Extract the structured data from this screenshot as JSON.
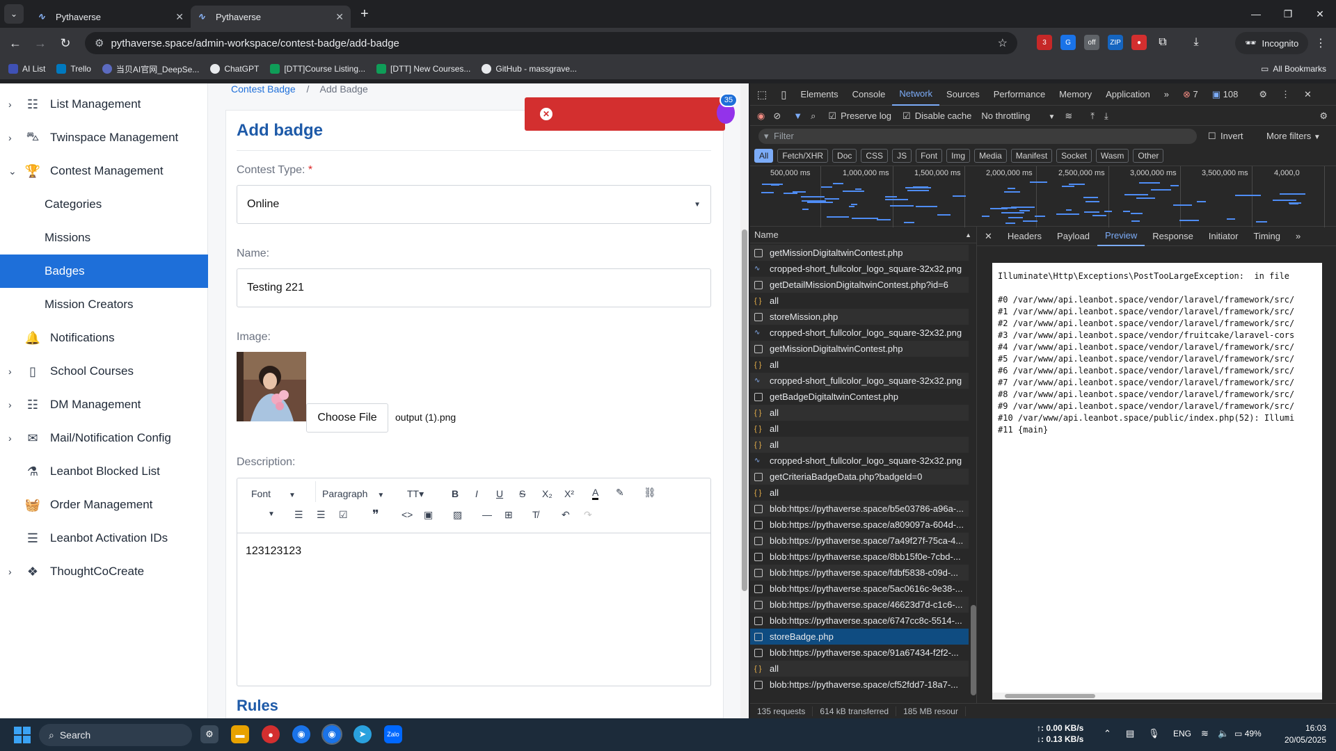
{
  "browser": {
    "tabs": [
      {
        "title": "Pythaverse"
      },
      {
        "title": "Pythaverse"
      }
    ],
    "url": "pythaverse.space/admin-workspace/contest-badge/add-badge",
    "incognito_label": "Incognito",
    "bookmarks": [
      "AI List",
      "Trello",
      "当贝AI官网_DeepSe...",
      "ChatGPT",
      "[DTT]Course Listing...",
      "[DTT] New Courses...",
      "GitHub - massgrave..."
    ],
    "all_bookmarks": "All Bookmarks"
  },
  "sidebar": {
    "items": [
      {
        "label": "List Management",
        "icon": "list-icon",
        "expandable": true,
        "chev": "›"
      },
      {
        "label": "Twinspace Management",
        "icon": "car-icon",
        "expandable": true,
        "chev": "›"
      },
      {
        "label": "Contest Management",
        "icon": "trophy-icon",
        "expandable": true,
        "chev": "⌄"
      },
      {
        "label": "Categories",
        "sub": true
      },
      {
        "label": "Missions",
        "sub": true
      },
      {
        "label": "Badges",
        "sub": true,
        "active": true
      },
      {
        "label": "Mission Creators",
        "sub": true
      },
      {
        "label": "Notifications",
        "icon": "bell-icon"
      },
      {
        "label": "School Courses",
        "icon": "book-icon",
        "expandable": true,
        "chev": "›"
      },
      {
        "label": "DM Management",
        "icon": "list-icon",
        "expandable": true,
        "chev": "›"
      },
      {
        "label": "Mail/Notification Config",
        "icon": "mail-icon",
        "expandable": true,
        "chev": "›"
      },
      {
        "label": "Leanbot Blocked List",
        "icon": "flask-icon"
      },
      {
        "label": "Order Management",
        "icon": "basket-icon"
      },
      {
        "label": "Leanbot Activation IDs",
        "icon": "checklist-icon"
      },
      {
        "label": "ThoughtCoCreate",
        "icon": "cubes-icon",
        "expandable": true,
        "chev": "›"
      }
    ]
  },
  "main": {
    "breadcrumb": {
      "parent": "Contest Badge",
      "sep": "/",
      "current": "Add Badge"
    },
    "title": "Add badge",
    "contest_type": {
      "label": "Contest Type:",
      "required": "*",
      "value": "Online"
    },
    "name": {
      "label": "Name:",
      "value": "Testing 221"
    },
    "image": {
      "label": "Image:",
      "button": "Choose File",
      "filename": "output (1).png"
    },
    "description": {
      "label": "Description:",
      "font": "Font",
      "paragraph": "Paragraph",
      "text": "123123123"
    },
    "rules_heading": "Rules",
    "notification_count": "35"
  },
  "devtools": {
    "tabs": [
      "Elements",
      "Console",
      "Network",
      "Sources",
      "Performance",
      "Memory",
      "Application"
    ],
    "active_tab": "Network",
    "errors": "7",
    "messages": "108",
    "toolbar": {
      "preserve_log": "Preserve log",
      "disable_cache": "Disable cache",
      "throttling": "No throttling"
    },
    "filter_placeholder": "Filter",
    "invert": "Invert",
    "more_filters": "More filters",
    "type_filters": [
      "All",
      "Fetch/XHR",
      "Doc",
      "CSS",
      "JS",
      "Font",
      "Img",
      "Media",
      "Manifest",
      "Socket",
      "Wasm",
      "Other"
    ],
    "timeline_labels": [
      "500,000 ms",
      "1,000,000 ms",
      "1,500,000 ms",
      "2,000,000 ms",
      "2,500,000 ms",
      "3,000,000 ms",
      "3,500,000 ms",
      "4,000,0"
    ],
    "name_header": "Name",
    "requests": [
      {
        "name": "getMissionDigitaltwinContest.php",
        "type": "doc"
      },
      {
        "name": "cropped-short_fullcolor_logo_square-32x32.png",
        "type": "img"
      },
      {
        "name": "getDetailMissionDigitaltwinContest.php?id=6",
        "type": "doc"
      },
      {
        "name": "all",
        "type": "fetch"
      },
      {
        "name": "storeMission.php",
        "type": "doc"
      },
      {
        "name": "cropped-short_fullcolor_logo_square-32x32.png",
        "type": "img"
      },
      {
        "name": "getMissionDigitaltwinContest.php",
        "type": "doc"
      },
      {
        "name": "all",
        "type": "fetch"
      },
      {
        "name": "cropped-short_fullcolor_logo_square-32x32.png",
        "type": "img"
      },
      {
        "name": "getBadgeDigitaltwinContest.php",
        "type": "doc"
      },
      {
        "name": "all",
        "type": "fetch"
      },
      {
        "name": "all",
        "type": "fetch"
      },
      {
        "name": "all",
        "type": "fetch"
      },
      {
        "name": "cropped-short_fullcolor_logo_square-32x32.png",
        "type": "img"
      },
      {
        "name": "getCriteriaBadgeData.php?badgeId=0",
        "type": "doc"
      },
      {
        "name": "all",
        "type": "fetch"
      },
      {
        "name": "blob:https://pythaverse.space/b5e03786-a96a-...",
        "type": "doc"
      },
      {
        "name": "blob:https://pythaverse.space/a809097a-604d-...",
        "type": "doc"
      },
      {
        "name": "blob:https://pythaverse.space/7a49f27f-75ca-4...",
        "type": "doc"
      },
      {
        "name": "blob:https://pythaverse.space/8bb15f0e-7cbd-...",
        "type": "doc"
      },
      {
        "name": "blob:https://pythaverse.space/fdbf5838-c09d-...",
        "type": "doc"
      },
      {
        "name": "blob:https://pythaverse.space/5ac0616c-9e38-...",
        "type": "doc"
      },
      {
        "name": "blob:https://pythaverse.space/46623d7d-c1c6-...",
        "type": "doc"
      },
      {
        "name": "blob:https://pythaverse.space/6747cc8c-5514-...",
        "type": "doc"
      },
      {
        "name": "storeBadge.php",
        "type": "doc",
        "selected": true
      },
      {
        "name": "blob:https://pythaverse.space/91a67434-f2f2-...",
        "type": "doc"
      },
      {
        "name": "all",
        "type": "fetch"
      },
      {
        "name": "blob:https://pythaverse.space/cf52fdd7-18a7-...",
        "type": "doc"
      }
    ],
    "panel_tabs": [
      "Headers",
      "Payload",
      "Preview",
      "Response",
      "Initiator",
      "Timing"
    ],
    "active_panel_tab": "Preview",
    "preview_lines": [
      "Illuminate\\Http\\Exceptions\\PostTooLargeException:  in file",
      "",
      "#0 /var/www/api.leanbot.space/vendor/laravel/framework/src/",
      "#1 /var/www/api.leanbot.space/vendor/laravel/framework/src/",
      "#2 /var/www/api.leanbot.space/vendor/laravel/framework/src/",
      "#3 /var/www/api.leanbot.space/vendor/fruitcake/laravel-cors",
      "#4 /var/www/api.leanbot.space/vendor/laravel/framework/src/",
      "#5 /var/www/api.leanbot.space/vendor/laravel/framework/src/",
      "#6 /var/www/api.leanbot.space/vendor/laravel/framework/src/",
      "#7 /var/www/api.leanbot.space/vendor/laravel/framework/src/",
      "#8 /var/www/api.leanbot.space/vendor/laravel/framework/src/",
      "#9 /var/www/api.leanbot.space/vendor/laravel/framework/src/",
      "#10 /var/www/api.leanbot.space/public/index.php(52): Illumi",
      "#11 {main}"
    ],
    "status": {
      "requests": "135 requests",
      "transferred": "614 kB transferred",
      "resources": "185 MB resour"
    }
  },
  "taskbar": {
    "search": "Search",
    "net_up": "↑: 0.00 KB/s",
    "net_down": "↓: 0.13 KB/s",
    "lang": "ENG",
    "battery": "49%",
    "time": "16:03",
    "date": "20/05/2025"
  }
}
